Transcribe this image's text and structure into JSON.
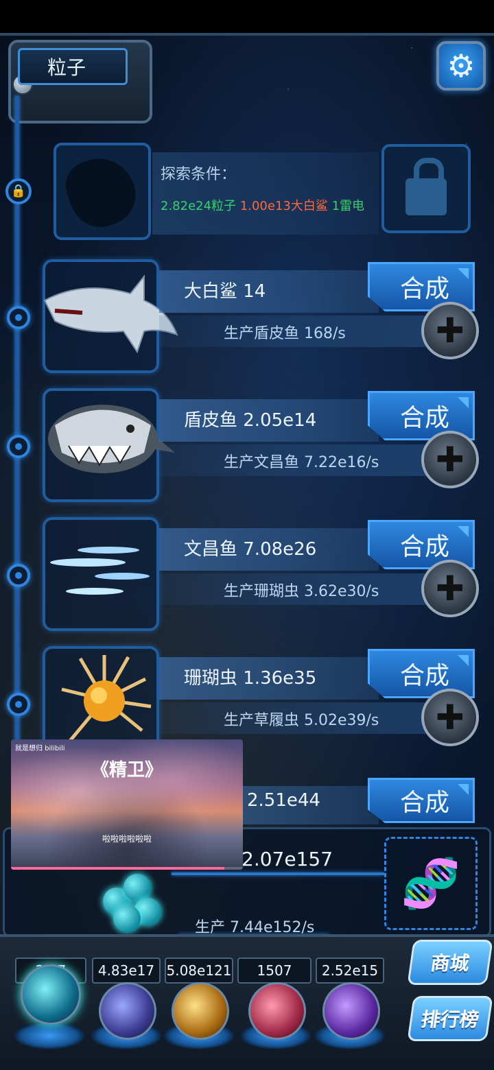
{
  "header": {
    "title": "粒子"
  },
  "locked": {
    "condition_title": "探索条件：",
    "req_particles": "2.82e24粒子",
    "req_shark": "1.00e13大白鲨",
    "req_lightning": "1雷电"
  },
  "rows": [
    {
      "name": "大白鲨 14",
      "merge_label": "合成",
      "production": "生产盾皮鱼 168/s",
      "icon": "great-white-shark-icon"
    },
    {
      "name": "盾皮鱼 2.05e14",
      "merge_label": "合成",
      "production": "生产文昌鱼 7.22e16/s",
      "icon": "dunkleosteus-icon"
    },
    {
      "name": "文昌鱼 7.08e26",
      "merge_label": "合成",
      "production": "生产珊瑚虫 3.62e30/s",
      "icon": "lancelet-icon"
    },
    {
      "name": "珊瑚虫 1.36e35",
      "merge_label": "合成",
      "production": "生产草履虫 5.02e39/s",
      "icon": "coral-polyp-icon"
    },
    {
      "name": "2.51e44",
      "merge_label": "合成",
      "production": "",
      "icon": "paramecium-icon"
    }
  ],
  "particle": {
    "value": "2.07e157",
    "rate": "生产 7.44e152/s"
  },
  "video": {
    "tag": "就是想归 bilibili",
    "title": "《精卫》",
    "subtitle": "啦啦啦啦啦啦",
    "progress": 0.92
  },
  "resources": [
    "2.07e157",
    "4.83e17",
    "5.08e121",
    "1507",
    "2.52e15"
  ],
  "resource_display": [
    "2    57",
    "4.83e17",
    "5.08e121",
    "1507",
    "2.52e15"
  ],
  "buttons": {
    "shop": "商城",
    "ranking": "排行榜"
  }
}
